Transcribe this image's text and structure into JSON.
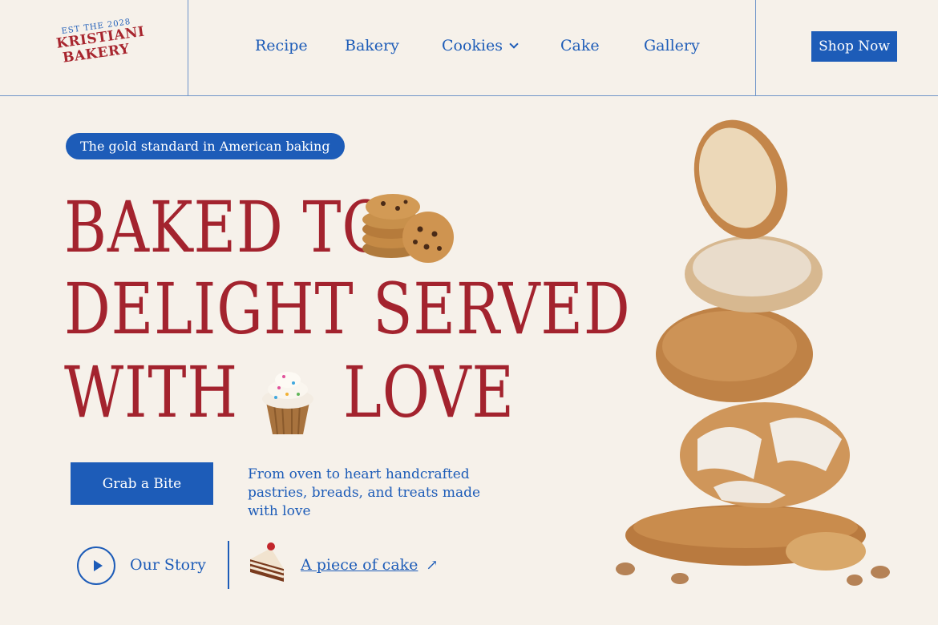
{
  "logo": {
    "est": "EST THE 2028",
    "line1": "KRISTIANI",
    "line2": "BAKERY"
  },
  "nav": {
    "items": [
      {
        "label": "Recipe"
      },
      {
        "label": "Bakery"
      },
      {
        "label": "Cookies"
      },
      {
        "label": "Cake"
      },
      {
        "label": "Gallery"
      }
    ],
    "shop_label": "Shop Now"
  },
  "hero": {
    "tagline": "The gold standard in American baking",
    "headline": {
      "line1": "BAKED TO",
      "line2": "DELIGHT SERVED",
      "line3a": "WITH",
      "line3b": "LOVE"
    },
    "cta_label": "Grab a Bite",
    "description": "From oven to heart handcrafted pastries, breads, and treats made with love",
    "story_label": "Our Story",
    "cake_link_label": "A piece of cake"
  },
  "colors": {
    "primary_blue": "#1d5cb8",
    "headline_red": "#a3232e",
    "background": "#f6f1ea"
  },
  "icons": [
    "chevron-down-icon",
    "play-icon",
    "arrow-up-right-icon"
  ]
}
